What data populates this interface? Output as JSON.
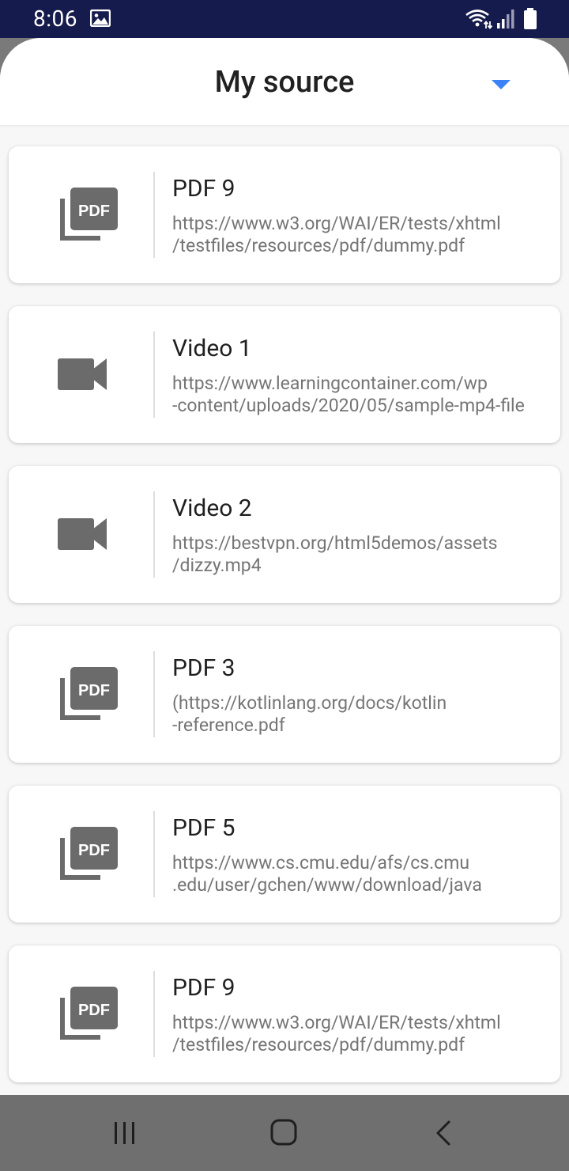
{
  "status_bar": {
    "time": "8:06",
    "icons": [
      "gallery-icon",
      "wifi-icon",
      "signal-icon",
      "battery-icon"
    ]
  },
  "header": {
    "title": "My source",
    "dropdown_icon": "dropdown-arrow-icon",
    "accent_color": "#3b82f6"
  },
  "sources": [
    {
      "type": "pdf",
      "icon": "pdf-icon",
      "title": "PDF 9",
      "url": "https://www.w3.org/WAI/ER/tests/xhtml/testfiles/resources/pdf/dummy.pdf",
      "url_line1": "https://www.w3.org/WAI/ER/tests/xhtml",
      "url_line2": "/testfiles/resources/pdf/dummy.pdf"
    },
    {
      "type": "video",
      "icon": "video-camera-icon",
      "title": "Video 1",
      "url": "https://www.learningcontainer.com/wp-content/uploads/2020/05/sample-mp4-file",
      "url_line1": "https://www.learningcontainer.com/wp",
      "url_line2": "-content/uploads/2020/05/sample-mp4-file"
    },
    {
      "type": "video",
      "icon": "video-camera-icon",
      "title": "Video 2",
      "url": "https://bestvpn.org/html5demos/assets/dizzy.mp4",
      "url_line1": "https://bestvpn.org/html5demos/assets",
      "url_line2": "/dizzy.mp4"
    },
    {
      "type": "pdf",
      "icon": "pdf-icon",
      "title": "PDF 3",
      "url": "(https://kotlinlang.org/docs/kotlin-reference.pdf",
      "url_line1": "(https://kotlinlang.org/docs/kotlin",
      "url_line2": "-reference.pdf"
    },
    {
      "type": "pdf",
      "icon": "pdf-icon",
      "title": "PDF 5",
      "url": "https://www.cs.cmu.edu/afs/cs.cmu.edu/user/gchen/www/download/java",
      "url_line1": "https://www.cs.cmu.edu/afs/cs.cmu",
      "url_line2": ".edu/user/gchen/www/download/java"
    },
    {
      "type": "pdf",
      "icon": "pdf-icon",
      "title": "PDF 9",
      "url": "https://www.w3.org/WAI/ER/tests/xhtml/testfiles/resources/pdf/dummy.pdf",
      "url_line1": "https://www.w3.org/WAI/ER/tests/xhtml",
      "url_line2": "/testfiles/resources/pdf/dummy.pdf"
    }
  ],
  "nav_bar": {
    "icons": [
      "recents-icon",
      "home-icon",
      "back-icon"
    ]
  },
  "colors": {
    "status_bar_bg": "#161b4d",
    "icon_gray": "#6b6b6b",
    "nav_bar_bg": "#6f6f6f"
  }
}
